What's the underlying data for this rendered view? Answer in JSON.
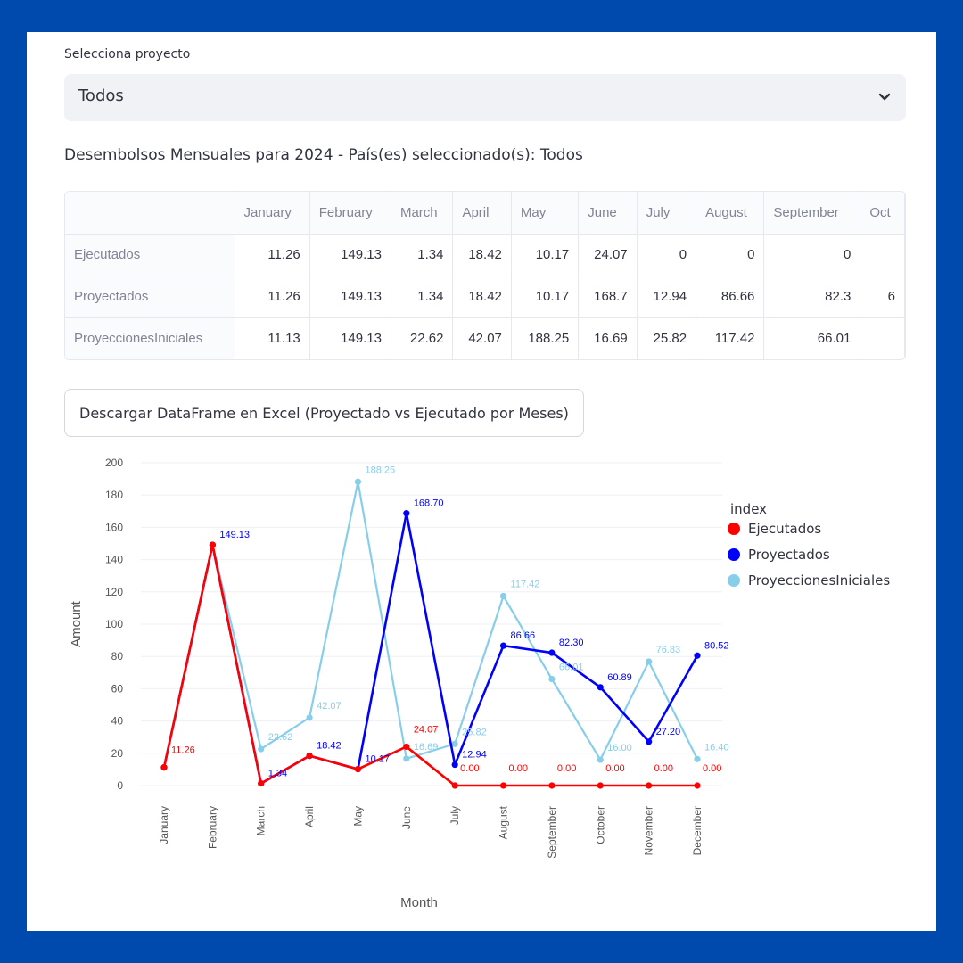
{
  "select": {
    "label": "Selecciona proyecto",
    "value": "Todos",
    "icon": "chevron-down-icon"
  },
  "subtitle": "Desembolsos Mensuales para 2024 - País(es) seleccionado(s): Todos",
  "table": {
    "columns": [
      "",
      "January",
      "February",
      "March",
      "April",
      "May",
      "June",
      "July",
      "August",
      "September",
      "Oct"
    ],
    "rows": [
      {
        "label": "Ejecutados",
        "cells": [
          "11.26",
          "149.13",
          "1.34",
          "18.42",
          "10.17",
          "24.07",
          "0",
          "0",
          "0",
          ""
        ]
      },
      {
        "label": "Proyectados",
        "cells": [
          "11.26",
          "149.13",
          "1.34",
          "18.42",
          "10.17",
          "168.7",
          "12.94",
          "86.66",
          "82.3",
          "6"
        ]
      },
      {
        "label": "ProyeccionesIniciales",
        "cells": [
          "11.13",
          "149.13",
          "22.62",
          "42.07",
          "188.25",
          "16.69",
          "25.82",
          "117.42",
          "66.01",
          ""
        ]
      }
    ]
  },
  "download_button": "Descargar DataFrame en Excel (Proyectado vs Ejecutado por Meses)",
  "chart_data": {
    "type": "line",
    "title": "",
    "xlabel": "Month",
    "ylabel": "Amount",
    "ylim": [
      0,
      200
    ],
    "yticks": [
      0,
      20,
      40,
      60,
      80,
      100,
      120,
      140,
      160,
      180,
      200
    ],
    "grid": true,
    "legend_title": "index",
    "legend_position": "right",
    "categories": [
      "January",
      "February",
      "March",
      "April",
      "May",
      "June",
      "July",
      "August",
      "September",
      "October",
      "November",
      "December"
    ],
    "series": [
      {
        "name": "ProyeccionesIniciales",
        "color": "#87ceeb",
        "values": [
          11.13,
          149.13,
          22.62,
          42.07,
          188.25,
          16.69,
          25.82,
          117.42,
          66.01,
          16.0,
          76.83,
          16.4
        ],
        "labels": [
          "",
          "",
          "22.62",
          "42.07",
          "188.25",
          "16.69",
          "25.82",
          "117.42",
          "66.01",
          "16.00",
          "76.83",
          "16.40"
        ]
      },
      {
        "name": "Proyectados",
        "color": "#0000ff",
        "values": [
          11.26,
          149.13,
          1.34,
          18.42,
          10.17,
          168.7,
          12.94,
          86.66,
          82.3,
          60.89,
          27.2,
          80.52
        ],
        "labels": [
          "",
          "149.13",
          "1.34",
          "18.42",
          "10.17",
          "168.70",
          "12.94",
          "86.66",
          "82.30",
          "60.89",
          "27.20",
          "80.52"
        ]
      },
      {
        "name": "Ejecutados",
        "color": "#ff0000",
        "values": [
          11.26,
          149.13,
          1.34,
          18.42,
          10.17,
          24.07,
          0.0,
          0.0,
          0.0,
          0.0,
          0.0,
          0.0
        ],
        "labels": [
          "11.26",
          "",
          "",
          "",
          "",
          "24.07",
          "0.00",
          "0.00",
          "0.00",
          "0.00",
          "0.00",
          "0.00"
        ]
      }
    ],
    "legend_order": [
      "Ejecutados",
      "Proyectados",
      "ProyeccionesIniciales"
    ]
  }
}
